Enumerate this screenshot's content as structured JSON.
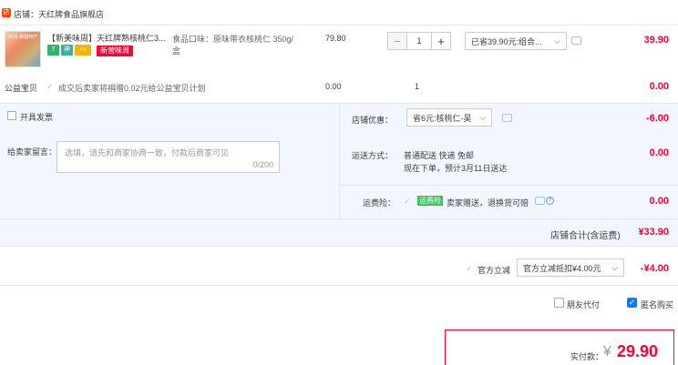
{
  "shop": {
    "icon": "shop-icon",
    "label": "店铺：天红牌食品旗舰店"
  },
  "product": {
    "thumb_text": "3/5月 新疆特产",
    "title": "【新美味周】天红牌熟核桃仁3...",
    "tags": [
      "7",
      "神",
      "▭"
    ],
    "promo_tag": "新营味周",
    "spec": "食品口味：原味带衣核桃仁 350g/盒",
    "price": "79.80",
    "quantity": "1",
    "discount_select": "已省39.90元:组合...",
    "amount": "39.90"
  },
  "charity": {
    "label": "公益宝贝",
    "text": "成交后卖家将捐赠0.02元给公益宝贝计划",
    "price": "0.00",
    "quantity": "1",
    "amount": "0.00"
  },
  "invoice": {
    "label": "开具发票"
  },
  "message": {
    "label": "给卖家留言：",
    "placeholder": "选填，请先和商家协商一致，付款后商家可见",
    "counter": "0/200"
  },
  "shop_discount": {
    "label": "店铺优惠：",
    "select": "省6元:核桃仁-吴",
    "amount": "-6.00"
  },
  "shipping": {
    "label": "运送方式：",
    "line1": "普通配送 快递 免邮",
    "line2": "现在下单，预计3月11日送达",
    "amount": "0.00"
  },
  "insurance": {
    "label": "运费险：",
    "tag": "运费险",
    "text": "卖家赠送，退换货可赔",
    "amount": "0.00"
  },
  "shop_total": {
    "label": "店铺合计(含运费)",
    "amount": "¥33.90"
  },
  "official": {
    "label": "官方立减",
    "select": "官方立减抵扣¥4.00元",
    "amount": "-¥4.00"
  },
  "options": {
    "friend_pay": "朋友代付",
    "anonymous": "匿名购买"
  },
  "pay": {
    "label": "实付款：",
    "currency": "¥",
    "amount": "29.90"
  }
}
